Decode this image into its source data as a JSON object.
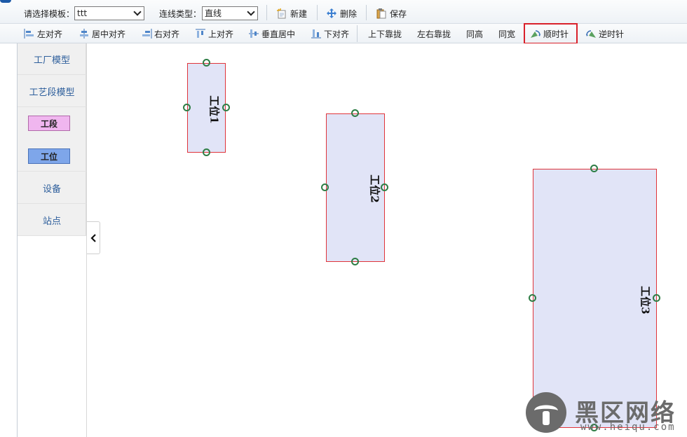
{
  "toolbar": {
    "template_label": "请选择模板：",
    "template_value": "ttt",
    "line_type_label": "连线类型：",
    "line_type_value": "直线",
    "new_label": "新建",
    "delete_label": "删除",
    "save_label": "保存"
  },
  "align_bar": {
    "align_left": "左对齐",
    "align_center": "居中对齐",
    "align_right": "右对齐",
    "align_top": "上对齐",
    "align_middle": "垂直居中",
    "align_bottom": "下对齐",
    "stack_vertical": "上下靠拢",
    "stack_horizontal": "左右靠拢",
    "same_height": "同高",
    "same_width": "同宽",
    "rotate_cw": "顺时针",
    "rotate_ccw": "逆时针"
  },
  "palette": {
    "factory_model": "工厂模型",
    "process_segment_model": "工艺段模型",
    "segment": "工段",
    "station": "工位",
    "equipment": "设备",
    "stop": "站点",
    "segment_color": "#f0b6ef",
    "station_color": "#7ea6ea"
  },
  "nodes": [
    {
      "label": "工位1"
    },
    {
      "label": "工位2"
    },
    {
      "label": "工位3"
    }
  ],
  "watermark": {
    "text": "黑区网络",
    "url": "www.heiqu.com"
  },
  "colors": {
    "node_fill": "#e1e4f7",
    "node_border": "#e0343a",
    "handle": "#2e7d45",
    "highlight": "#d9202a",
    "palette_text": "#2e5f9c"
  }
}
